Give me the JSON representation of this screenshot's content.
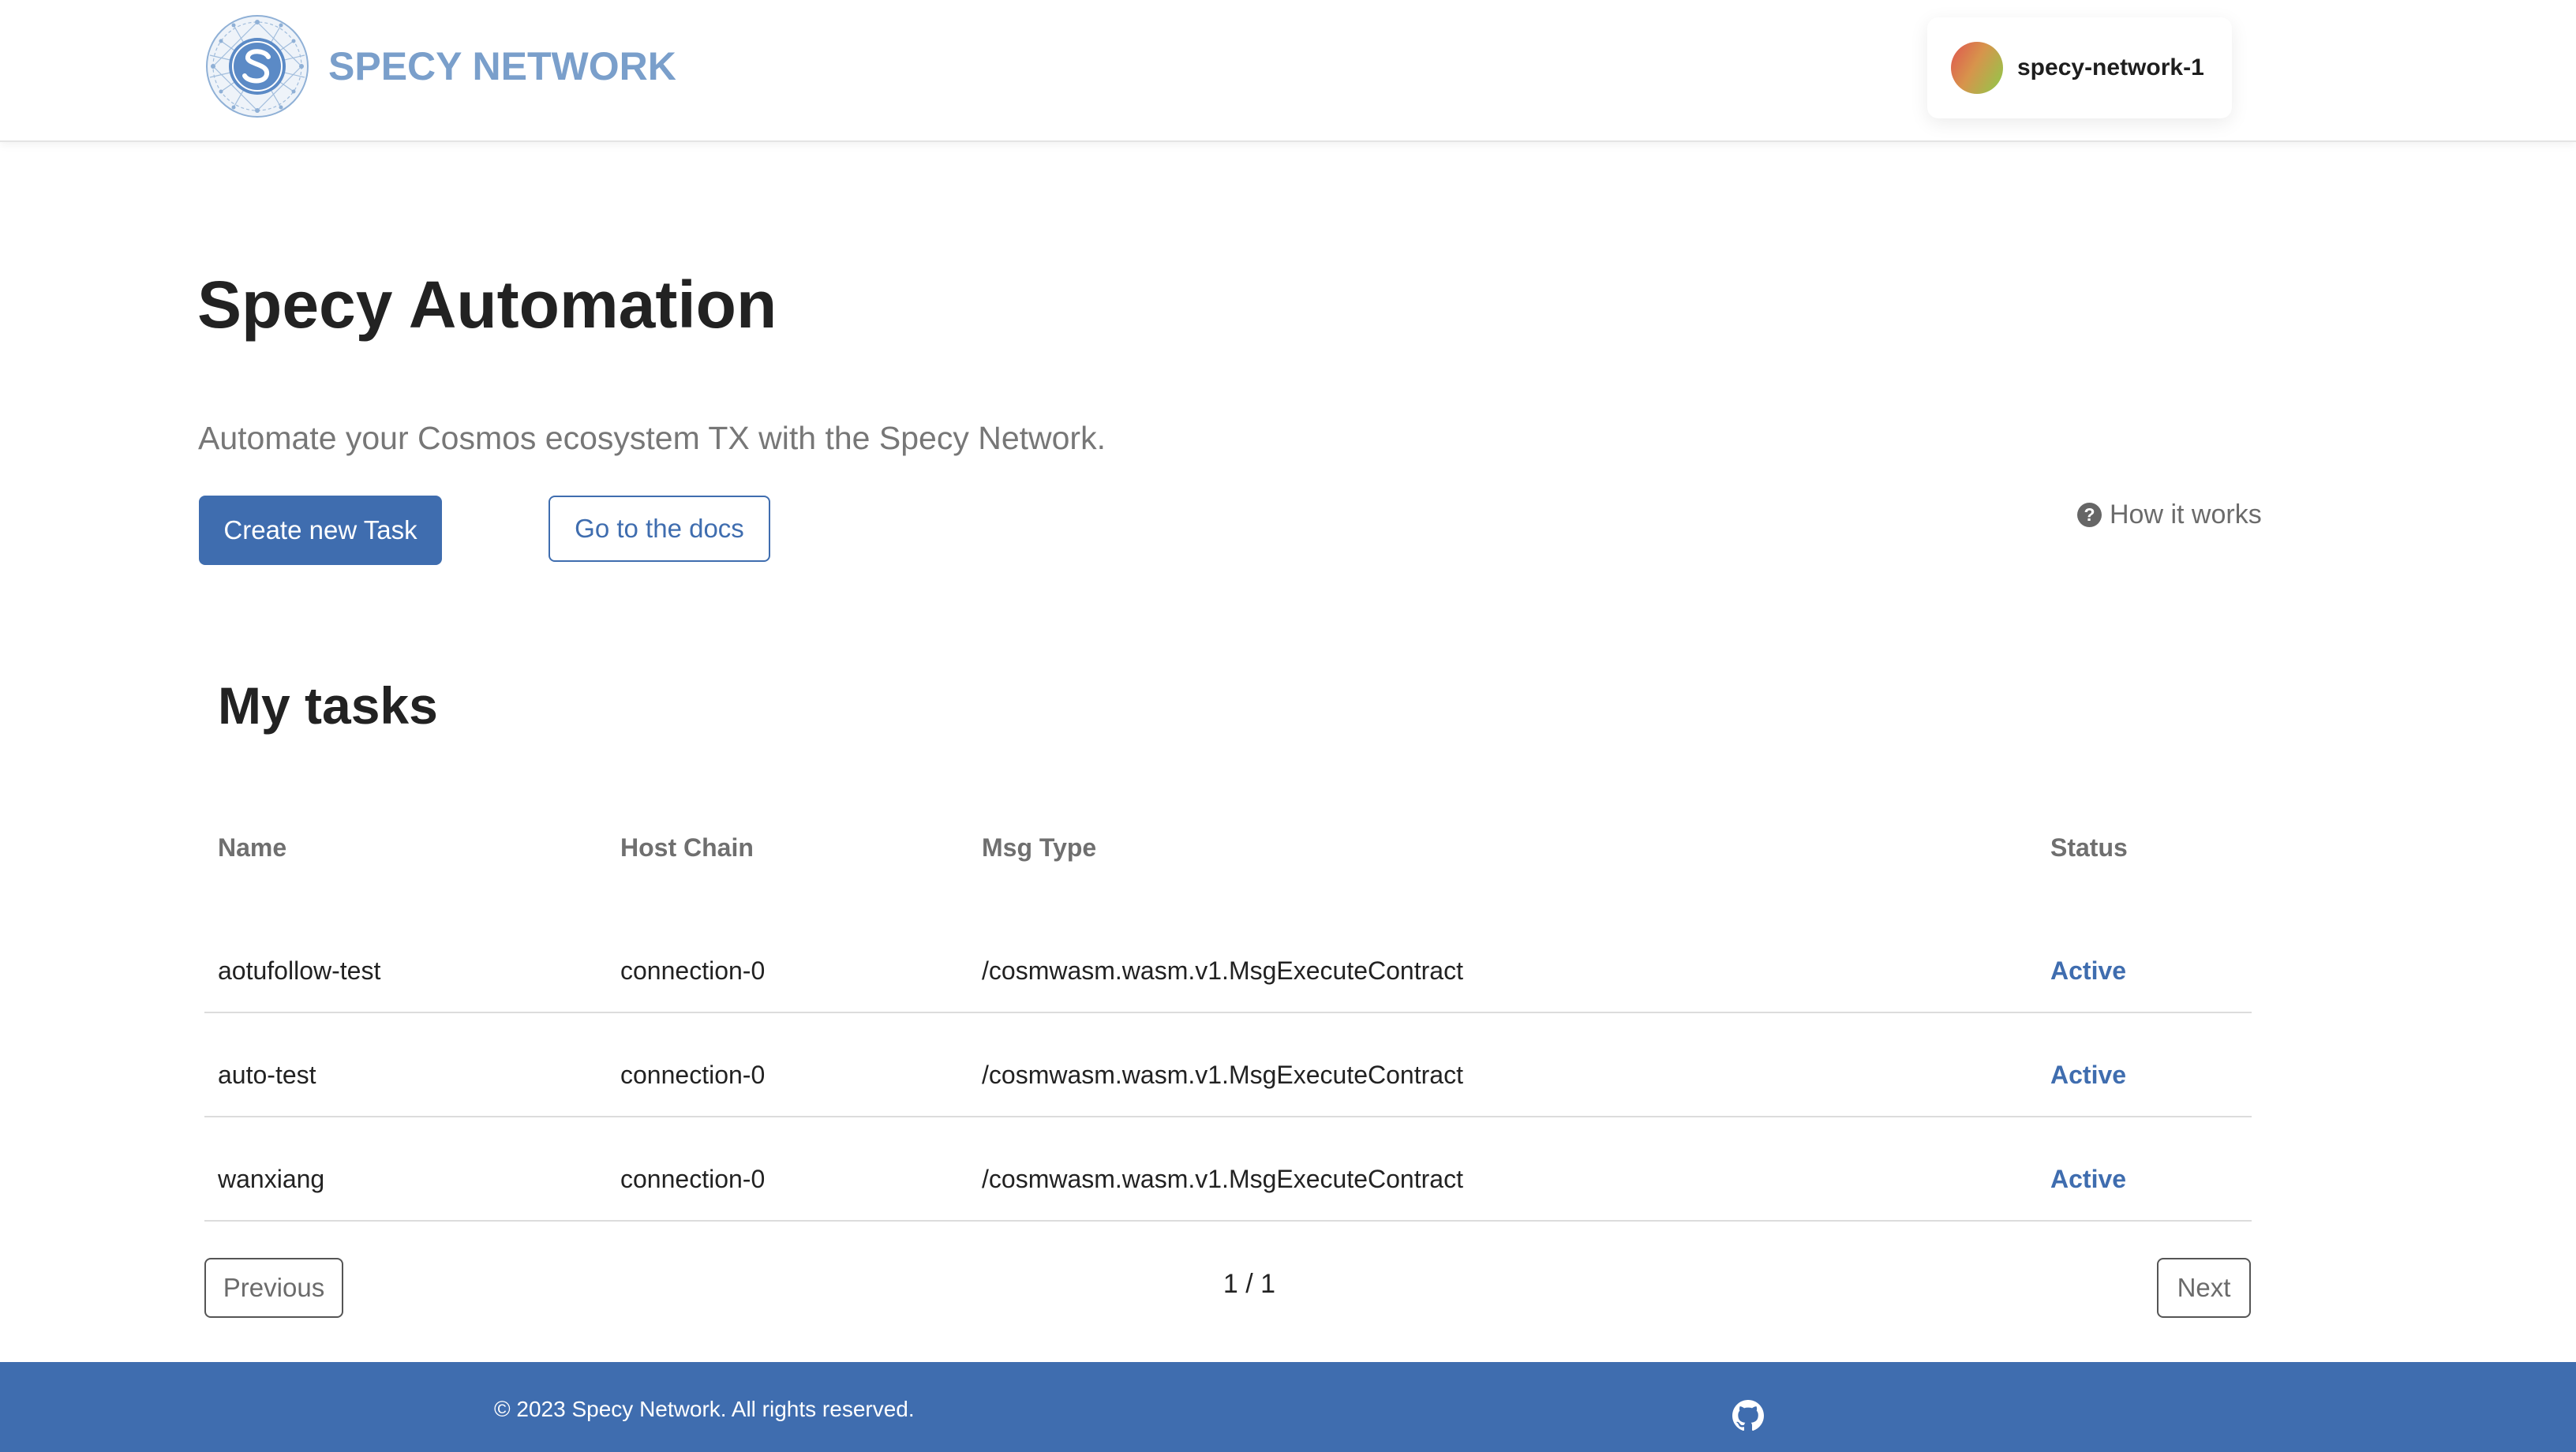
{
  "header": {
    "brand_name": "SPECY NETWORK",
    "logo_icon": "specy-network-logo",
    "network": {
      "name": "specy-network-1",
      "icon": "network-avatar-dot"
    }
  },
  "hero": {
    "title": "Specy Automation",
    "subtitle": "Automate your Cosmos ecosystem TX with the Specy Network.",
    "create_button": "Create new Task",
    "docs_button": "Go to the docs",
    "how_it_works": "How it works",
    "how_it_works_icon": "question-circle-icon"
  },
  "tasks": {
    "title": "My tasks",
    "columns": {
      "name": "Name",
      "host_chain": "Host Chain",
      "msg_type": "Msg Type",
      "status": "Status"
    },
    "rows": [
      {
        "name": "aotufollow-test",
        "host_chain": "connection-0",
        "msg_type": "/cosmwasm.wasm.v1.MsgExecuteContract",
        "status": "Active"
      },
      {
        "name": "auto-test",
        "host_chain": "connection-0",
        "msg_type": "/cosmwasm.wasm.v1.MsgExecuteContract",
        "status": "Active"
      },
      {
        "name": "wanxiang",
        "host_chain": "connection-0",
        "msg_type": "/cosmwasm.wasm.v1.MsgExecuteContract",
        "status": "Active"
      }
    ]
  },
  "pagination": {
    "previous": "Previous",
    "page_label": "1 / 1",
    "next": "Next"
  },
  "footer": {
    "copyright": "© 2023 Specy Network. All rights reserved.",
    "github_icon": "github-icon"
  },
  "colors": {
    "primary": "#3f6daf",
    "brand_text": "#7a9fcb",
    "muted_text": "#777777",
    "footer_bg": "#3f6daf"
  }
}
